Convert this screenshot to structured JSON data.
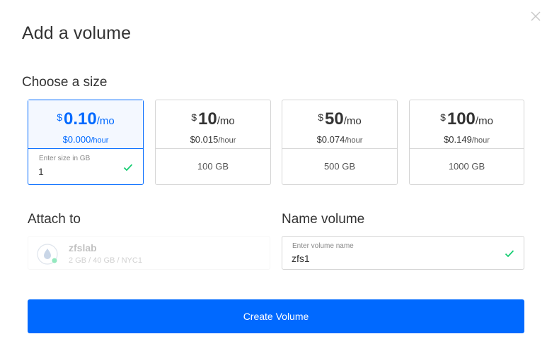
{
  "dialog": {
    "title": "Add a volume",
    "close_icon": "close-icon"
  },
  "size_section": {
    "heading": "Choose a size",
    "currency": "$",
    "per_month": "/mo",
    "per_hour": "/hour",
    "options": [
      {
        "price": "0.10",
        "hourly": "$0.000",
        "custom_label": "Enter size in GB",
        "custom_value": "1",
        "selected": true
      },
      {
        "price": "10",
        "hourly": "$0.015",
        "size": "100 GB",
        "selected": false
      },
      {
        "price": "50",
        "hourly": "$0.074",
        "size": "500 GB",
        "selected": false
      },
      {
        "price": "100",
        "hourly": "$0.149",
        "size": "1000 GB",
        "selected": false
      }
    ]
  },
  "attach": {
    "heading": "Attach to",
    "droplet_name": "zfslab",
    "droplet_meta": "2 GB / 40 GB / NYC1",
    "disabled": true
  },
  "name_volume": {
    "heading": "Name volume",
    "label": "Enter volume name",
    "value": "zfs1"
  },
  "actions": {
    "create_label": "Create Volume"
  },
  "colors": {
    "primary": "#0069ff",
    "valid_check": "#15cd72",
    "border": "#d5d5d5",
    "text": "#333333"
  }
}
